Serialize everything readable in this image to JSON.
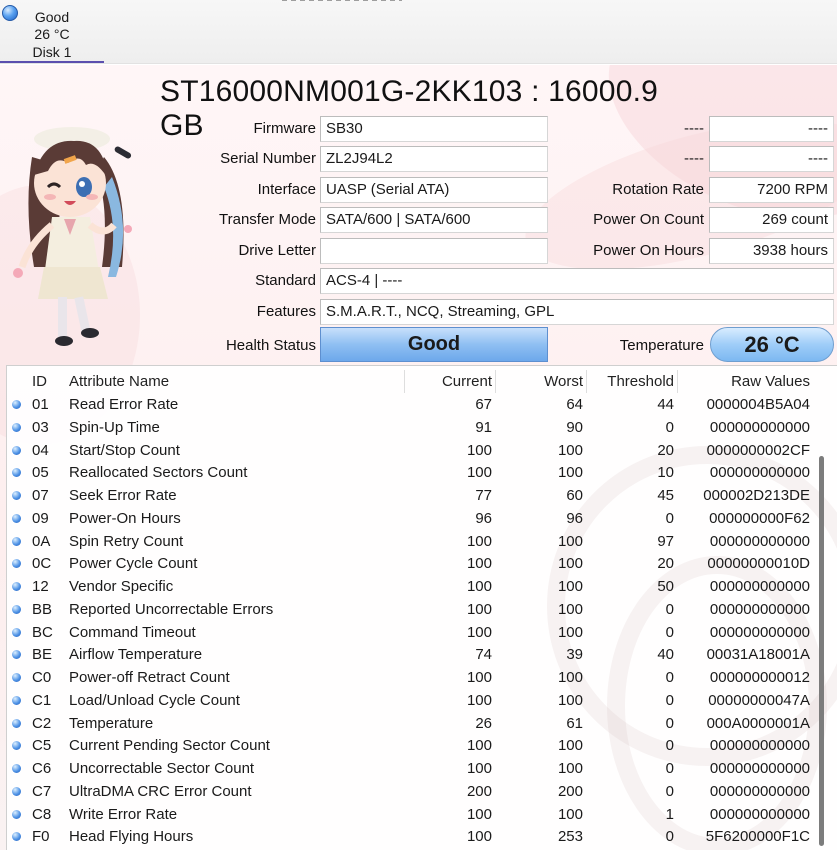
{
  "disk_tab": {
    "status": "Good",
    "temperature": "26 °C",
    "name": "Disk 1"
  },
  "drive": {
    "title": "ST16000NM001G-2KK103 : 16000.9 GB",
    "firmware_label": "Firmware",
    "firmware": "SB30",
    "serial_label": "Serial Number",
    "serial": "ZL2J94L2",
    "interface_label": "Interface",
    "interface": "UASP (Serial ATA)",
    "transfer_label": "Transfer Mode",
    "transfer": "SATA/600 | SATA/600",
    "letter_label": "Drive Letter",
    "letter": "",
    "standard_label": "Standard",
    "standard": "ACS-4 | ----",
    "features_label": "Features",
    "features": "S.M.A.R.T., NCQ, Streaming, GPL",
    "dash1_label": "----",
    "dash1_value": "----",
    "dash2_label": "----",
    "dash2_value": "----",
    "rotation_label": "Rotation Rate",
    "rotation": "7200 RPM",
    "poc_label": "Power On Count",
    "poc": "269 count",
    "poh_label": "Power On Hours",
    "poh": "3938 hours",
    "health_label": "Health Status",
    "health": "Good",
    "temp_label": "Temperature",
    "temp": "26 °C"
  },
  "colors": {
    "health_blue": "#8fbff2",
    "status_dot": "#4f93e6",
    "background_pink": "#fdeeee"
  },
  "icons": {
    "status": "status-dot-icon",
    "mascot": "anime-mascot-illustration"
  },
  "table": {
    "headers": [
      "ID",
      "Attribute Name",
      "Current",
      "Worst",
      "Threshold",
      "Raw Values"
    ],
    "rows": [
      {
        "id": "01",
        "name": "Read Error Rate",
        "cur": "67",
        "worst": "64",
        "thr": "44",
        "raw": "0000004B5A04"
      },
      {
        "id": "03",
        "name": "Spin-Up Time",
        "cur": "91",
        "worst": "90",
        "thr": "0",
        "raw": "000000000000"
      },
      {
        "id": "04",
        "name": "Start/Stop Count",
        "cur": "100",
        "worst": "100",
        "thr": "20",
        "raw": "0000000002CF"
      },
      {
        "id": "05",
        "name": "Reallocated Sectors Count",
        "cur": "100",
        "worst": "100",
        "thr": "10",
        "raw": "000000000000"
      },
      {
        "id": "07",
        "name": "Seek Error Rate",
        "cur": "77",
        "worst": "60",
        "thr": "45",
        "raw": "000002D213DE"
      },
      {
        "id": "09",
        "name": "Power-On Hours",
        "cur": "96",
        "worst": "96",
        "thr": "0",
        "raw": "000000000F62"
      },
      {
        "id": "0A",
        "name": "Spin Retry Count",
        "cur": "100",
        "worst": "100",
        "thr": "97",
        "raw": "000000000000"
      },
      {
        "id": "0C",
        "name": "Power Cycle Count",
        "cur": "100",
        "worst": "100",
        "thr": "20",
        "raw": "00000000010D"
      },
      {
        "id": "12",
        "name": "Vendor Specific",
        "cur": "100",
        "worst": "100",
        "thr": "50",
        "raw": "000000000000"
      },
      {
        "id": "BB",
        "name": "Reported Uncorrectable Errors",
        "cur": "100",
        "worst": "100",
        "thr": "0",
        "raw": "000000000000"
      },
      {
        "id": "BC",
        "name": "Command Timeout",
        "cur": "100",
        "worst": "100",
        "thr": "0",
        "raw": "000000000000"
      },
      {
        "id": "BE",
        "name": "Airflow Temperature",
        "cur": "74",
        "worst": "39",
        "thr": "40",
        "raw": "00031A18001A"
      },
      {
        "id": "C0",
        "name": "Power-off Retract Count",
        "cur": "100",
        "worst": "100",
        "thr": "0",
        "raw": "000000000012"
      },
      {
        "id": "C1",
        "name": "Load/Unload Cycle Count",
        "cur": "100",
        "worst": "100",
        "thr": "0",
        "raw": "00000000047A"
      },
      {
        "id": "C2",
        "name": "Temperature",
        "cur": "26",
        "worst": "61",
        "thr": "0",
        "raw": "000A0000001A"
      },
      {
        "id": "C5",
        "name": "Current Pending Sector Count",
        "cur": "100",
        "worst": "100",
        "thr": "0",
        "raw": "000000000000"
      },
      {
        "id": "C6",
        "name": "Uncorrectable Sector Count",
        "cur": "100",
        "worst": "100",
        "thr": "0",
        "raw": "000000000000"
      },
      {
        "id": "C7",
        "name": "UltraDMA CRC Error Count",
        "cur": "200",
        "worst": "200",
        "thr": "0",
        "raw": "000000000000"
      },
      {
        "id": "C8",
        "name": "Write Error Rate",
        "cur": "100",
        "worst": "100",
        "thr": "1",
        "raw": "000000000000"
      },
      {
        "id": "F0",
        "name": "Head Flying Hours",
        "cur": "100",
        "worst": "253",
        "thr": "0",
        "raw": "5F6200000F1C"
      }
    ]
  }
}
